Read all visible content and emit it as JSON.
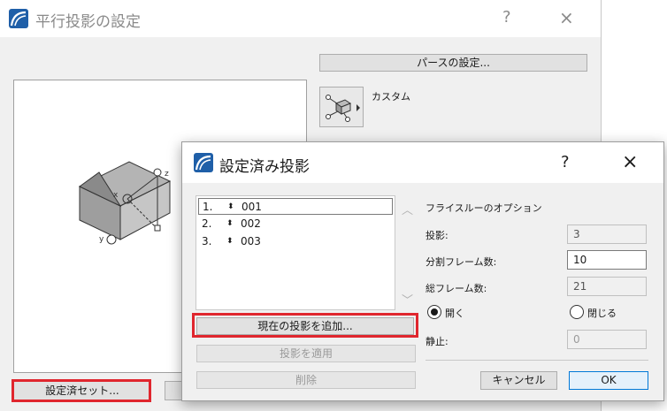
{
  "background_dialog": {
    "title": "平行投影の設定",
    "help_glyph": "?",
    "close_glyph": "×",
    "perspective_button": "パースの設定...",
    "camera_mode": "カスタム",
    "preset_sets_button": "設定済セット...",
    "axis_labels": {
      "x": "x",
      "y": "y",
      "z": "z"
    }
  },
  "dialog": {
    "title": "設定済み投影",
    "help_glyph": "?",
    "close_glyph": "×",
    "projections": [
      {
        "index": "1.",
        "name": "001",
        "selected": true
      },
      {
        "index": "2.",
        "name": "002",
        "selected": false
      },
      {
        "index": "3.",
        "name": "003",
        "selected": false
      }
    ],
    "reorder_glyph": "⬍",
    "scroll_up_glyph": "︿",
    "scroll_down_glyph": "﹀",
    "add_current_button": "現在の投影を追加...",
    "apply_button": "投影を適用",
    "delete_button": "削除",
    "flythrough_options_label": "フライスルーのオプション",
    "projection_label": "投影:",
    "projection_value": "3",
    "division_frames_label": "分割フレーム数:",
    "division_frames_value": "10",
    "total_frames_label": "総フレーム数:",
    "total_frames_value": "21",
    "radio_open_label": "開く",
    "radio_close_label": "閉じる",
    "radio_selected": "open",
    "stop_label": "静止:",
    "stop_value": "0",
    "cancel_button": "キャンセル",
    "ok_button": "OK"
  },
  "colors": {
    "highlight_red": "#e0262e",
    "ok_border": "#0078d7",
    "app_logo": "#1f5fa8"
  }
}
